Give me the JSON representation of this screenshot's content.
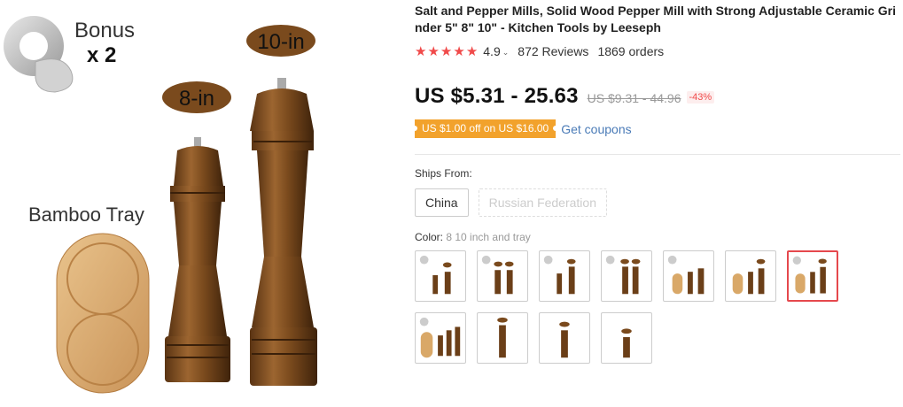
{
  "hero": {
    "bonus_text": "Bonus",
    "bonus_count": "x 2",
    "label_8": "8-in",
    "label_10": "10-in",
    "tray_label": "Bamboo Tray"
  },
  "product": {
    "title": "Salt and Pepper Mills, Solid Wood Pepper Mill with Strong Adjustable Ceramic Grinder 5\" 8\" 10\" - Kitchen Tools by Leeseph",
    "rating": "4.9",
    "stars": 5,
    "reviews": "872 Reviews",
    "orders": "1869 orders"
  },
  "price": {
    "current": "US $5.31 - 25.63",
    "original": "US $9.31 - 44.96",
    "discount": "-43%"
  },
  "coupon": {
    "text": "US $1.00 off on US $16.00",
    "link": "Get coupons"
  },
  "ships_from": {
    "label": "Ships From:",
    "options": [
      "China",
      "Russian Federation"
    ]
  },
  "color": {
    "label": "Color:",
    "selected": "8 10 inch and tray"
  },
  "colors": {
    "accent": "#e5484d",
    "star": "#f04a4a",
    "coupon": "#f2a22c",
    "link": "#4a7bb7",
    "wood": "#8b5a2b"
  }
}
